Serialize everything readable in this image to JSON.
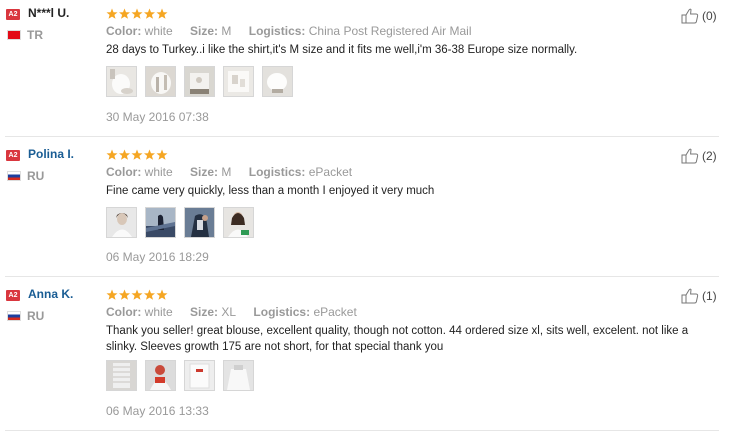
{
  "labels": {
    "color": "Color:",
    "size": "Size:",
    "logistics": "Logistics:"
  },
  "reviews": [
    {
      "badge": "A2",
      "name": "N***l U.",
      "country": "TR",
      "stars": 5,
      "color": "white",
      "size": "M",
      "logistics": "China Post Registered Air Mail",
      "text": "28 days to Turkey..i like the shirt,it's M size and it fits me well,i'm 36-38 Europe size normally.",
      "date": "30 May 2016 07:38",
      "helpful": "(0)"
    },
    {
      "badge": "A2",
      "name": "Polina I.",
      "country": "RU",
      "stars": 5,
      "color": "white",
      "size": "M",
      "logistics": "ePacket",
      "text": "Fine came very quickly, less than a month I enjoyed it very much",
      "date": "06 May 2016 18:29",
      "helpful": "(2)"
    },
    {
      "badge": "A2",
      "name": "Anna K.",
      "country": "RU",
      "stars": 5,
      "color": "white",
      "size": "XL",
      "logistics": "ePacket",
      "text": "Thank you seller! great blouse, excellent quality, though not cotton. 44 ordered size xl, sits well, excelent. not like a slinky. Sleeves growth 175 are not short, for that special thank you",
      "date": "06 May 2016 13:33",
      "helpful": "(1)"
    }
  ],
  "colors": {
    "star": "#f5a623",
    "name": "#1a5d94",
    "muted": "#999999",
    "badge": "#d9363e"
  },
  "icons": {
    "helpful": "thumbs-up-icon",
    "rating": "star-icon"
  }
}
